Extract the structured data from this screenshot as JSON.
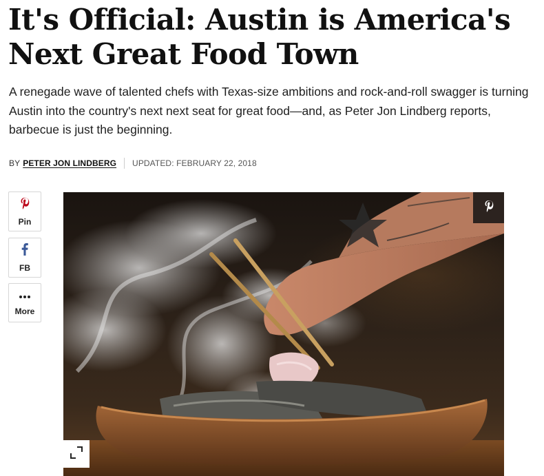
{
  "article": {
    "headline": "It's Official: Austin is America's Next Great Food Town",
    "dek": "A renegade wave of talented chefs with Texas-size ambitions and rock-and-roll swagger is turning Austin into the country's next next seat for great food—and, as Peter Jon Lindberg reports, barbecue is just the beginning.",
    "byline": {
      "prefix": "BY",
      "author": "PETER JON LINDBERG",
      "updated": "UPDATED: FEBRUARY 22, 2018"
    }
  },
  "share": {
    "pin_label": "Pin",
    "fb_label": "FB",
    "more_label": "More"
  },
  "icons": {
    "pinterest": "pinterest-icon",
    "facebook": "facebook-icon",
    "more": "ellipsis-icon",
    "expand": "expand-icon"
  },
  "colors": {
    "pinterest_red": "#bd081c",
    "facebook_blue": "#3b5998",
    "text": "#111111",
    "muted": "#555555"
  }
}
